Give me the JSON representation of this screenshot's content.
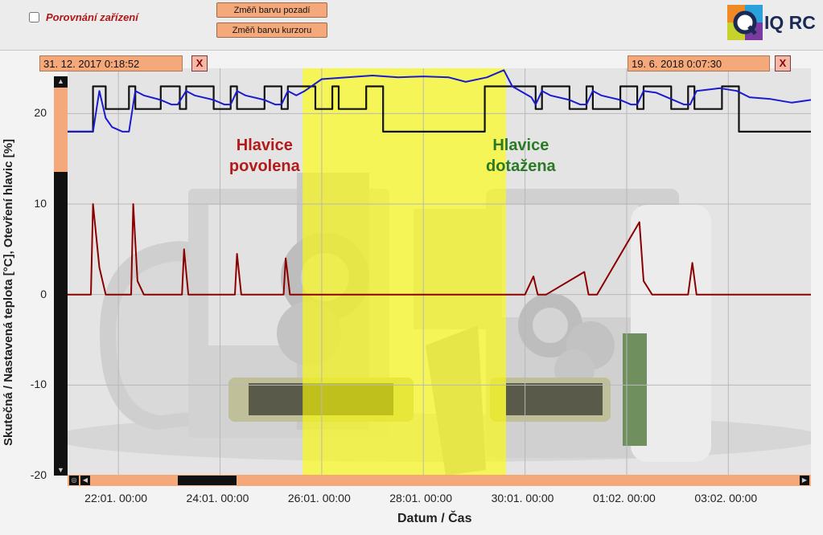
{
  "toolbar": {
    "compare_label": "Porovnání zařízení",
    "bg_color_button": "Změň barvu pozadí",
    "cursor_color_button": "Změň barvu kurzoru",
    "logo_text": "IQ RC"
  },
  "cursors": {
    "left_date": "31. 12. 2017 0:18:52",
    "right_date": "19. 6. 2018 0:07:30",
    "close_label": "X"
  },
  "chart_data": {
    "type": "line",
    "xlabel": "Datum / Čas",
    "ylabel": "Skutečná / Nastavená teplota [°C], Otevření hlavic [%]",
    "ylim": [
      -20,
      25
    ],
    "xlim": [
      "2018-01-21 00:00",
      "2018-02-04 15:00"
    ],
    "yticks": [
      -20,
      -10,
      0,
      10,
      20
    ],
    "xticks": [
      "22:01. 00:00",
      "24:01. 00:00",
      "26:01. 00:00",
      "28:01. 00:00",
      "30:01. 00:00",
      "01:02. 00:00",
      "03:02. 00:00"
    ],
    "grid": true,
    "highlight": {
      "from": "2018-01-25 15:00",
      "to": "2018-01-29 15:00",
      "color": "#ffff00"
    },
    "annotations": [
      {
        "lines": [
          "Hlavice",
          "povolena"
        ],
        "color": "#b31b1b",
        "x": "2018-01-24 21:00",
        "y": 15.3
      },
      {
        "lines": [
          "Hlavice",
          "dotažena"
        ],
        "color": "#2a7a25",
        "x": "2018-01-29 22:00",
        "y": 15.3
      }
    ],
    "series": [
      {
        "color": "#111111",
        "x": [
          "2018-01-21 00:00",
          "2018-01-21 12:00",
          "2018-01-21 12:00",
          "2018-01-21 18:00",
          "2018-01-21 18:00",
          "2018-01-22 05:00",
          "2018-01-22 05:00",
          "2018-01-22 08:00",
          "2018-01-22 08:00",
          "2018-01-22 20:00",
          "2018-01-22 20:00",
          "2018-01-23 05:00",
          "2018-01-23 05:00",
          "2018-01-23 08:00",
          "2018-01-23 08:00",
          "2018-01-23 21:00",
          "2018-01-23 21:00",
          "2018-01-24 05:00",
          "2018-01-24 05:00",
          "2018-01-24 08:00",
          "2018-01-24 08:00",
          "2018-01-24 21:00",
          "2018-01-24 21:00",
          "2018-01-25 05:00",
          "2018-01-25 05:00",
          "2018-01-25 08:00",
          "2018-01-25 08:00",
          "2018-01-25 21:00",
          "2018-01-25 21:00",
          "2018-01-26 05:00",
          "2018-01-26 05:00",
          "2018-01-26 08:00",
          "2018-01-26 08:00",
          "2018-01-26 21:00",
          "2018-01-26 21:00",
          "2018-01-27 05:00",
          "2018-01-27 05:00",
          "2018-01-29 05:00",
          "2018-01-29 05:00",
          "2018-01-30 05:00",
          "2018-01-30 05:00",
          "2018-01-30 08:00",
          "2018-01-30 08:00",
          "2018-01-30 21:00",
          "2018-01-30 21:00",
          "2018-01-31 05:00",
          "2018-01-31 05:00",
          "2018-01-31 08:00",
          "2018-01-31 08:00",
          "2018-01-31 21:00",
          "2018-01-31 21:00",
          "2018-02-01 05:00",
          "2018-02-01 05:00",
          "2018-02-01 08:00",
          "2018-02-01 08:00",
          "2018-02-01 21:00",
          "2018-02-01 21:00",
          "2018-02-02 05:00",
          "2018-02-02 05:00",
          "2018-02-02 08:00",
          "2018-02-02 08:00",
          "2018-02-02 21:00",
          "2018-02-02 21:00",
          "2018-02-03 05:00",
          "2018-02-03 05:00",
          "2018-02-04 15:00"
        ],
        "values": [
          18,
          18,
          23,
          23,
          20.5,
          20.5,
          23,
          23,
          20.5,
          20.5,
          23,
          23,
          20.5,
          20.5,
          23,
          23,
          20.5,
          20.5,
          23,
          23,
          20.5,
          20.5,
          23,
          23,
          20.5,
          20.5,
          23,
          23,
          20.5,
          20.5,
          23,
          23,
          20.5,
          20.5,
          23,
          23,
          18,
          18,
          23,
          23,
          20.5,
          20.5,
          23,
          23,
          20.5,
          20.5,
          23,
          23,
          20.5,
          20.5,
          23,
          23,
          20.5,
          20.5,
          23,
          23,
          20.5,
          20.5,
          23,
          23,
          20.5,
          20.5,
          23,
          23,
          18,
          18
        ]
      },
      {
        "color": "#1a1acf",
        "x": [
          "2018-01-21 00:00",
          "2018-01-21 12:00",
          "2018-01-21 15:00",
          "2018-01-21 18:00",
          "2018-01-21 21:00",
          "2018-01-22 02:00",
          "2018-01-22 05:00",
          "2018-01-22 08:00",
          "2018-01-22 12:00",
          "2018-01-22 20:00",
          "2018-01-23 01:00",
          "2018-01-23 04:00",
          "2018-01-23 08:00",
          "2018-01-23 12:00",
          "2018-01-23 21:00",
          "2018-01-24 02:00",
          "2018-01-24 05:00",
          "2018-01-24 08:00",
          "2018-01-24 12:00",
          "2018-01-24 21:00",
          "2018-01-25 02:00",
          "2018-01-25 05:00",
          "2018-01-25 08:00",
          "2018-01-25 12:00",
          "2018-01-25 16:00",
          "2018-01-26 00:00",
          "2018-01-26 12:00",
          "2018-01-27 00:00",
          "2018-01-27 12:00",
          "2018-01-28 00:00",
          "2018-01-28 12:00",
          "2018-01-28 20:00",
          "2018-01-29 06:00",
          "2018-01-29 14:00",
          "2018-01-29 18:00",
          "2018-01-30 03:00",
          "2018-01-30 05:00",
          "2018-01-30 08:00",
          "2018-01-30 12:00",
          "2018-01-30 21:00",
          "2018-01-31 02:00",
          "2018-01-31 05:00",
          "2018-01-31 08:00",
          "2018-01-31 12:00",
          "2018-01-31 21:00",
          "2018-02-01 02:00",
          "2018-02-01 05:00",
          "2018-02-01 08:00",
          "2018-02-01 14:00",
          "2018-02-01 21:00",
          "2018-02-02 03:00",
          "2018-02-02 06:00",
          "2018-02-02 09:00",
          "2018-02-02 20:00",
          "2018-02-03 04:00",
          "2018-02-03 10:00",
          "2018-02-03 20:00",
          "2018-02-04 06:00",
          "2018-02-04 15:00"
        ],
        "values": [
          18,
          18,
          22.5,
          19.5,
          18.5,
          18,
          18,
          22.5,
          22,
          21.5,
          21,
          21,
          22.5,
          22,
          21.5,
          21,
          21,
          22.5,
          22,
          21.5,
          21,
          21,
          22.5,
          22,
          22.5,
          23.8,
          24,
          24.2,
          24,
          24.1,
          24,
          23.5,
          24,
          24.8,
          23,
          21.8,
          21,
          22.5,
          22,
          21.5,
          21,
          21,
          22.5,
          22,
          21.5,
          21,
          21,
          22.5,
          22.3,
          21.6,
          21,
          21,
          22.5,
          22.8,
          22.5,
          21.8,
          21.6,
          21.2,
          21.5
        ]
      },
      {
        "color": "#8b0000",
        "x": [
          "2018-01-21 00:00",
          "2018-01-21 11:00",
          "2018-01-21 12:00",
          "2018-01-21 15:00",
          "2018-01-21 18:00",
          "2018-01-22 06:00",
          "2018-01-22 07:00",
          "2018-01-22 09:00",
          "2018-01-22 12:00",
          "2018-01-23 06:00",
          "2018-01-23 07:00",
          "2018-01-23 09:00",
          "2018-01-24 07:00",
          "2018-01-24 08:00",
          "2018-01-24 10:00",
          "2018-01-25 06:00",
          "2018-01-25 07:00",
          "2018-01-25 09:00",
          "2018-01-25 15:00",
          "2018-01-30 00:00",
          "2018-01-30 04:00",
          "2018-01-30 06:00",
          "2018-01-30 10:00",
          "2018-01-31 04:00",
          "2018-01-31 06:00",
          "2018-01-31 10:00",
          "2018-02-01 06:00",
          "2018-02-01 08:00",
          "2018-02-01 12:00",
          "2018-02-02 05:00",
          "2018-02-02 07:00",
          "2018-02-02 09:00",
          "2018-02-04 15:00"
        ],
        "values": [
          0,
          0,
          10,
          3,
          0,
          0,
          10,
          1.5,
          0,
          0,
          5,
          0,
          0,
          4.5,
          0,
          0,
          4,
          0,
          0,
          0,
          2,
          0,
          0,
          2.5,
          0,
          0,
          8,
          1.5,
          0,
          0,
          3.5,
          0,
          0
        ]
      }
    ]
  }
}
